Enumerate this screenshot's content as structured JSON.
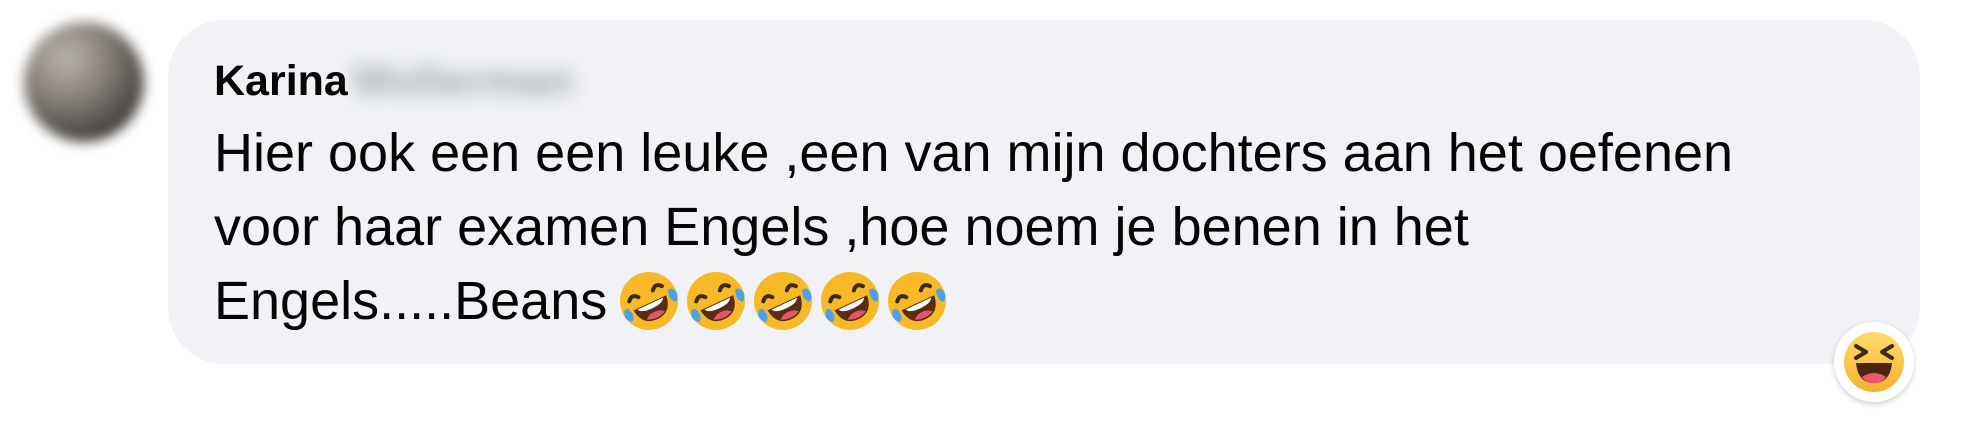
{
  "comment": {
    "author_first": "Karina",
    "author_last_blurred": "Wolterman",
    "text": "Hier ook een een leuke ,een van mijn dochters aan het oefenen\nvoor haar examen Engels ,hoe noem je benen in het\nEngels.....Beans",
    "trailing_emoji": [
      "rofl-emoji",
      "rofl-emoji",
      "rofl-emoji",
      "rofl-emoji",
      "rofl-emoji"
    ],
    "reaction": "haha-reaction",
    "colors": {
      "bubble": "#f0f2f5",
      "text": "#050505",
      "emoji_face": "#f7b928"
    }
  }
}
